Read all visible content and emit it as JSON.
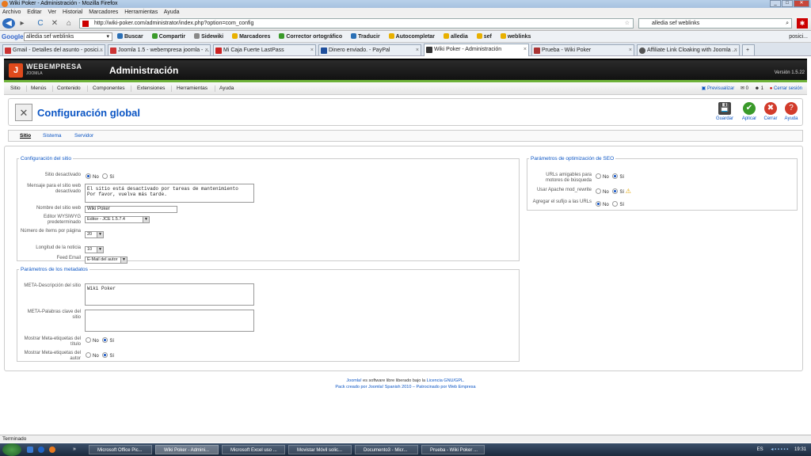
{
  "window": {
    "title": "Wiki Poker - Administración - Mozilla Firefox",
    "controls": [
      "_",
      "□",
      "✕"
    ]
  },
  "menubar": [
    "Archivo",
    "Editar",
    "Ver",
    "Historial",
    "Marcadores",
    "Herramientas",
    "Ayuda"
  ],
  "nav": {
    "url": "http://wiki-poker.com/administrator/index.php?option=com_config",
    "search_value": "alledia sef weblinks",
    "back": "◀",
    "forward": "▸",
    "reload": "C",
    "stop": "✕",
    "home": "⌂",
    "star": "☆",
    "addon": "✱"
  },
  "googlebar": {
    "logo": "Google",
    "query": "alledia sef weblinks",
    "items": [
      "Buscar",
      "Compartir",
      "Sidewiki",
      "Marcadores",
      "Corrector ortográfico",
      "Traducir",
      "Autocompletar",
      "alledia",
      "sef",
      "weblinks"
    ],
    "right": "posici..."
  },
  "tabs": [
    {
      "label": "Gmail - Detalles del asunto - posici...",
      "color": "#c33"
    },
    {
      "label": "Joomla 1.5 - webempresa joomla - ...",
      "color": "#c33"
    },
    {
      "label": "Mi Caja Fuerte LastPass",
      "color": "#c22"
    },
    {
      "label": "Dinero enviado. - PayPal",
      "color": "#1f4f9c"
    },
    {
      "label": "Wiki Poker - Administración",
      "color": "#333"
    },
    {
      "label": "Prueba - Wiki Poker",
      "color": "#a33"
    },
    {
      "label": "Affiliate Link Cloaking with Joomla ...",
      "color": "#555"
    }
  ],
  "tab_close": "×",
  "new_tab": "+",
  "joomla": {
    "logo_letter": "J",
    "brand": "WEBEMPRESA",
    "brand_sub": "JOOMLA",
    "admin": "Administración",
    "version": "Versión 1.5.22"
  },
  "adminmenu": {
    "items": [
      "Sitio",
      "Menús",
      "Contenido",
      "Componentes",
      "Extensiones",
      "Herramientas",
      "Ayuda"
    ],
    "preview": "Previsualizar",
    "msg_count": "0",
    "users_count": "1",
    "logout": "Cerrar sesión"
  },
  "page": {
    "title": "Configuración global",
    "config_icon": "✕"
  },
  "toolbar": [
    {
      "label": "Guardar",
      "icon": "💾",
      "color": "#444"
    },
    {
      "label": "Aplicar",
      "icon": "✔",
      "color": "#3a9a2a"
    },
    {
      "label": "Cerrar",
      "icon": "✖",
      "color": "#d23b2b"
    },
    {
      "label": "Ayuda",
      "icon": "?",
      "color": "#d23b2b"
    }
  ],
  "subtabs": [
    "Sitio",
    "Sistema",
    "Servidor"
  ],
  "site": {
    "legend": "Configuración del sitio",
    "offline_label": "Sitio desactivado",
    "no": "No",
    "yes": "Sí",
    "offline_msg_label": "Mensaje para el sitio web desactivado",
    "offline_msg": "El sitio está desactivado por tareas de mantenimiento\nPor favor, vuelva más tarde.",
    "sitename_label": "Nombre del sitio web",
    "sitename": "Wiki Poker",
    "editor_label": "Editor WYSIWYG predeterminado",
    "editor": "Editor - JCE 1.5.7.4",
    "listlimit_label": "Número de ítems por página",
    "listlimit": "20",
    "feedlimit_label": "Longitud de la noticia",
    "feedlimit": "10",
    "feedemail_label": "Feed Email",
    "feedemail": "E-Mail del autor"
  },
  "meta": {
    "legend": "Parámetros de los metadatos",
    "desc_label": "META-Descripción del sitio",
    "desc": "Wiki Poker",
    "keys_label": "META-Palabras clave del sitio",
    "keys": "",
    "title_label": "Mostrar Meta-etiquetas del título",
    "author_label": "Mostrar Meta-etiquetas del autor"
  },
  "seo": {
    "legend": "Parámetros de optimización de SEO",
    "sef_label": "URLs amigables para motores de búsqueda",
    "rewrite_label": "Usar Apache mod_rewrite",
    "suffix_label": "Agregar el sufijo a las URLs",
    "warn": "⚠"
  },
  "footer": {
    "l1a": "Joomla!",
    "l1b": " es software libre liberado bajo la ",
    "l1c": "Licencia GNU/GPL.",
    "l2a": "Pack creado por Joomla! Spanish 2010 – ",
    "l2b": "Patrocinado por Web Empresa"
  },
  "status": "Terminado",
  "taskbar": {
    "quicklaunch": "»",
    "items": [
      "Microsoft Office Pic...",
      "Wiki Poker - Admini...",
      "Microsoft Excel uso ...",
      "Movistar Móvil solic...",
      "Documento3 - Micr...",
      "Prueba - Wiki Poker ..."
    ],
    "lang": "ES",
    "clock": "19:31"
  }
}
